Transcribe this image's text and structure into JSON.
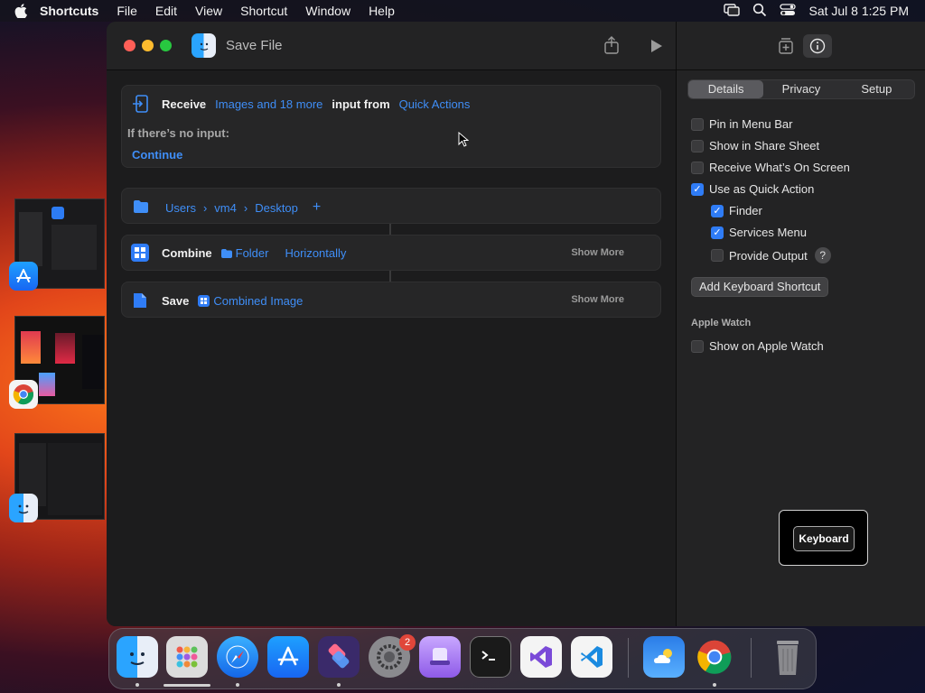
{
  "menubar": {
    "app": "Shortcuts",
    "items": [
      "File",
      "Edit",
      "View",
      "Shortcut",
      "Window",
      "Help"
    ],
    "datetime": "Sat Jul 8  1:25 PM"
  },
  "window": {
    "title": "Save File"
  },
  "receive": {
    "label": "Receive",
    "types": "Images and 18 more",
    "input_from_label": "input from",
    "source": "Quick Actions",
    "no_input_label": "If there’s no input:",
    "no_input_value": "Continue"
  },
  "path": {
    "items": [
      "Users",
      "vm4",
      "Desktop"
    ],
    "add": "+"
  },
  "combine": {
    "label": "Combine",
    "input": "Folder",
    "mode": "Horizontally",
    "show_more": "Show More"
  },
  "save": {
    "label": "Save",
    "input": "Combined Image",
    "show_more": "Show More"
  },
  "inspector": {
    "tabs": [
      "Details",
      "Privacy",
      "Setup"
    ],
    "selected_tab": "Details",
    "options": [
      {
        "label": "Pin in Menu Bar",
        "checked": false
      },
      {
        "label": "Show in Share Sheet",
        "checked": false
      },
      {
        "label": "Receive What’s On Screen",
        "checked": false
      },
      {
        "label": "Use as Quick Action",
        "checked": true
      }
    ],
    "sub_options": [
      {
        "label": "Finder",
        "checked": true
      },
      {
        "label": "Services Menu",
        "checked": true
      },
      {
        "label": "Provide Output",
        "checked": false
      }
    ],
    "help": "?",
    "add_shortcut_button": "Add Keyboard Shortcut",
    "watch_section": "Apple Watch",
    "watch_option": {
      "label": "Show on Apple Watch",
      "checked": false
    }
  },
  "tooltip": {
    "label": "Keyboard"
  },
  "dock": {
    "badge": "2",
    "apps": [
      "finder-icon",
      "launchpad-icon",
      "safari-icon",
      "app-store-icon",
      "shortcuts-icon",
      "system-settings-icon",
      "podcasts-icon",
      "terminal-icon",
      "visual-studio-icon",
      "vscode-icon",
      "weather-icon",
      "chrome-icon",
      "trash-icon"
    ]
  },
  "colors": {
    "accent": "#3f8ef7",
    "checkbox_on": "#2f7cf6",
    "badge": "#e0463a"
  }
}
